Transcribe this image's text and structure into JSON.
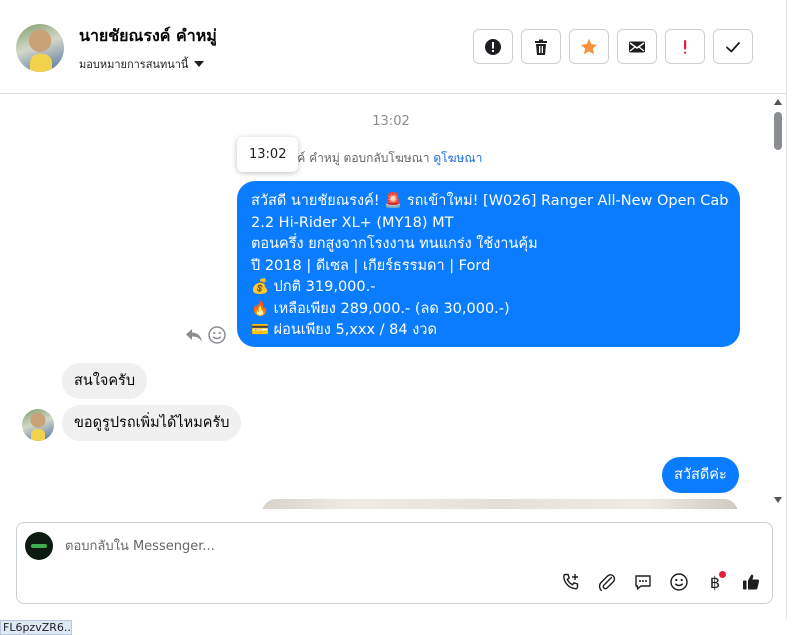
{
  "header": {
    "contact_name": "นายชัยณรงค์ คำหมู่",
    "assign_label": "มอบหมายการสนทนานี้",
    "actions": [
      "mark-spam",
      "delete",
      "star",
      "mark-unread",
      "important",
      "done"
    ]
  },
  "chat": {
    "timestamp": "13:02",
    "tooltip_time": "13:02",
    "reply_note": "รงค์ คำหมู่ ตอบกลับโฆษณา",
    "reply_note_link": "ดูโฆษณา",
    "outgoing_ad_lines": [
      "สวัสดี นายชัยณรงค์! 🚨 รถเข้าใหม่! [W026] Ranger All-New Open Cab",
      "2.2 Hi-Rider XL+ (MY18) MT",
      "ตอนครึ่ง ยกสูงจากโรงงาน ทนแกร่ง ใช้งานคุ้ม",
      "ปี 2018 | ดีเซล | เกียร์ธรรมดา | Ford",
      "💰 ปกติ 319,000.-",
      "🔥 เหลือเพียง 289,000.- (ลด 30,000.-)",
      "💳 ผ่อนเพียง 5,xxx / 84 งวด"
    ],
    "incoming_1": "สนใจครับ",
    "incoming_2": "ขอดูรูปรถเพิ่มได้ไหมครับ",
    "outgoing_2": "สวัสดีค่ะ"
  },
  "composer": {
    "placeholder": "ตอบกลับใน Messenger...",
    "tools": [
      "call-add-icon",
      "attach-icon",
      "saved-reply-icon",
      "emoji-icon",
      "payment-icon",
      "like-icon"
    ],
    "currency_symbol": "฿"
  },
  "statusbar": {
    "text": "FL6pzvZR6..."
  }
}
